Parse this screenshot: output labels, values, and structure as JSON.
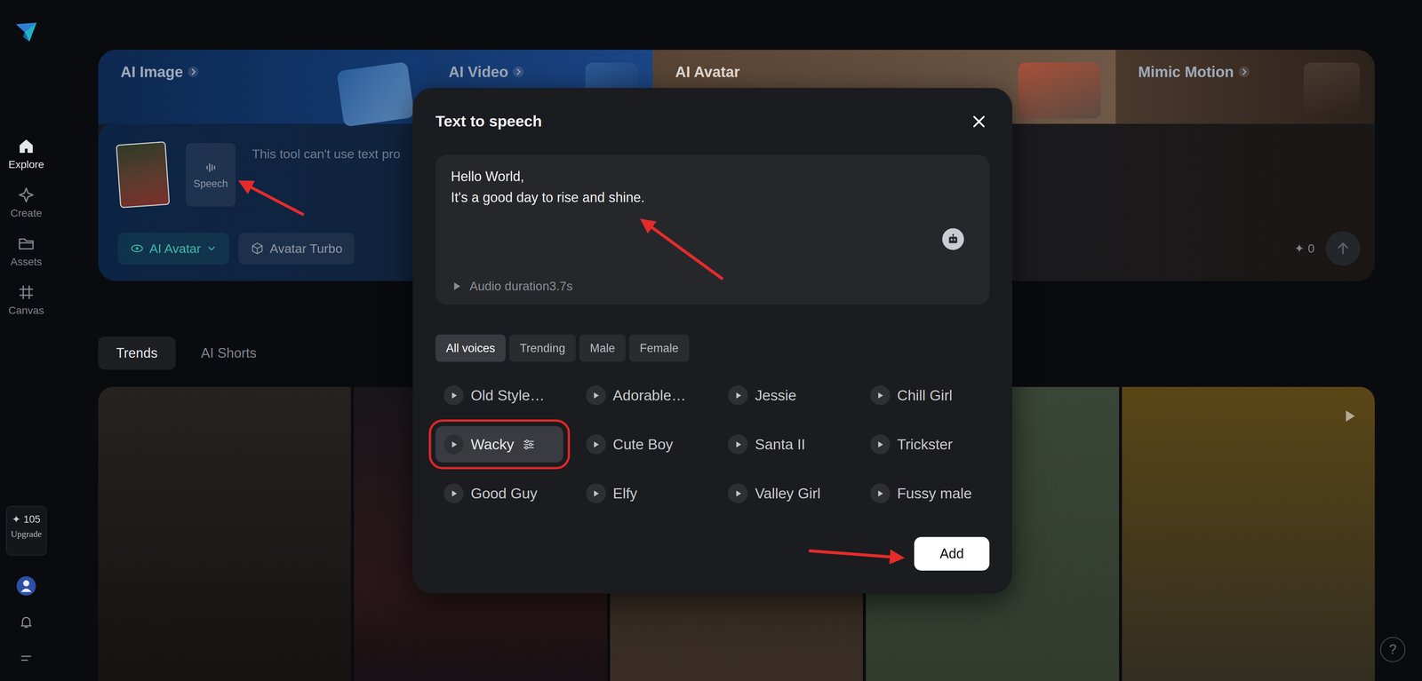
{
  "sidebar": {
    "items": [
      {
        "label": "Explore",
        "selected": true
      },
      {
        "label": "Create",
        "selected": false
      },
      {
        "label": "Assets",
        "selected": false
      },
      {
        "label": "Canvas",
        "selected": false
      }
    ],
    "credits": {
      "icon": "✦",
      "count": "105",
      "upgrade": "Upgrade"
    }
  },
  "banner": {
    "tabs": [
      {
        "label": "AI Image",
        "selected": false
      },
      {
        "label": "AI Video",
        "selected": false
      },
      {
        "label": "AI Avatar",
        "selected": true
      },
      {
        "label": "Mimic Motion",
        "selected": false
      }
    ],
    "prompt": {
      "speech": "Speech",
      "placeholder": "This tool can't use text pro",
      "mode": "AI Avatar",
      "model": "Avatar Turbo",
      "cost_icon": "✦",
      "cost": "0"
    }
  },
  "feed": {
    "tabs": [
      {
        "label": "Trends",
        "selected": true
      },
      {
        "label": "AI Shorts",
        "selected": false
      }
    ],
    "items": [
      {
        "kind": "image"
      },
      {
        "kind": "image"
      },
      {
        "kind": "image"
      },
      {
        "kind": "image"
      },
      {
        "kind": "video"
      }
    ]
  },
  "help": "?",
  "dialog": {
    "title": "Text to speech",
    "text": "Hello World,\nIt's a good day to rise and shine.",
    "audio_duration": "Audio duration3.7s",
    "filters": [
      {
        "label": "All voices",
        "selected": true
      },
      {
        "label": "Trending",
        "selected": false
      },
      {
        "label": "Male",
        "selected": false
      },
      {
        "label": "Female",
        "selected": false
      }
    ],
    "voices": [
      {
        "name": "Old Style…",
        "selected": false
      },
      {
        "name": "Adorable…",
        "selected": false
      },
      {
        "name": "Jessie",
        "selected": false
      },
      {
        "name": "Chill Girl",
        "selected": false
      },
      {
        "name": "Wacky",
        "selected": true
      },
      {
        "name": "Cute Boy",
        "selected": false
      },
      {
        "name": "Santa II",
        "selected": false
      },
      {
        "name": "Trickster",
        "selected": false
      },
      {
        "name": "Good Guy",
        "selected": false
      },
      {
        "name": "Elfy",
        "selected": false
      },
      {
        "name": "Valley Girl",
        "selected": false
      },
      {
        "name": "Fussy male",
        "selected": false
      }
    ],
    "add": "Add"
  }
}
